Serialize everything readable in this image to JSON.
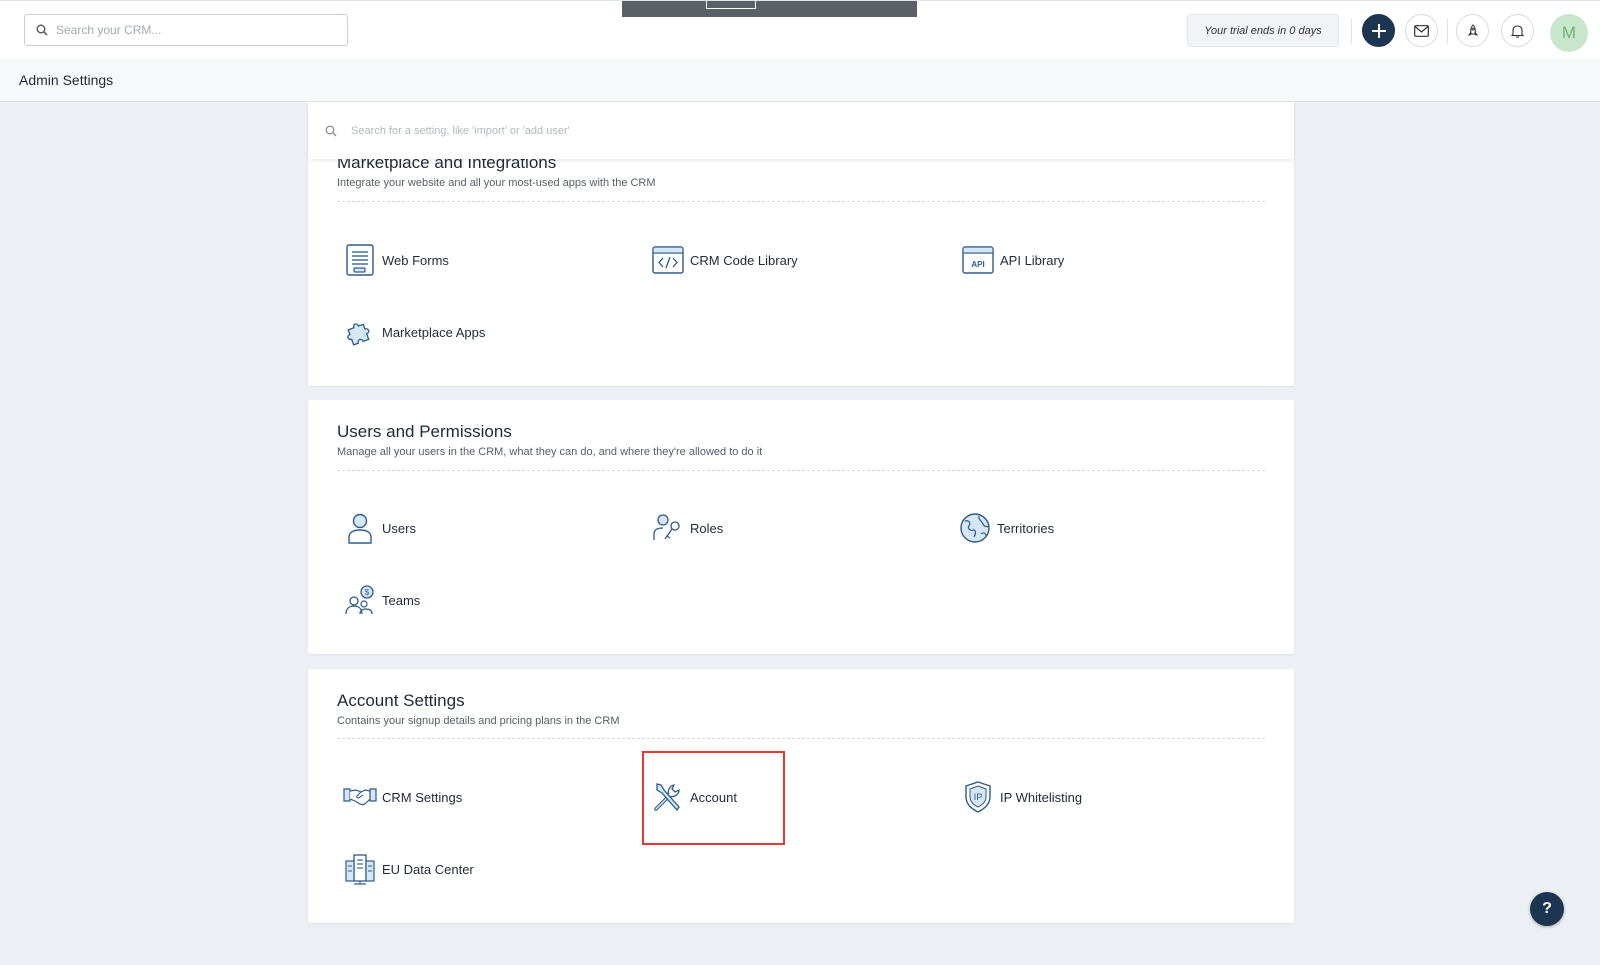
{
  "topbar": {
    "search_placeholder": "Search your CRM...",
    "trial_text": "Your trial ends in 0 days",
    "avatar_initial": "M",
    "icons": [
      "search-icon",
      "plus-icon",
      "mail-icon",
      "rocket-icon",
      "bell-icon"
    ]
  },
  "header": {
    "title": "Admin Settings"
  },
  "settings_search": {
    "placeholder": "Search for a setting, like 'import' or 'add user'"
  },
  "sections": {
    "marketplace": {
      "title": "Marketplace and Integrations",
      "description": "Integrate your website and all your most-used apps with the CRM",
      "items": [
        {
          "label": "Web Forms",
          "icon": "web-forms-icon"
        },
        {
          "label": "CRM Code Library",
          "icon": "code-library-icon"
        },
        {
          "label": "API Library",
          "icon": "api-icon"
        },
        {
          "label": "Marketplace Apps",
          "icon": "puzzle-icon"
        }
      ]
    },
    "users": {
      "title": "Users and Permissions",
      "description": "Manage all your users in the CRM, what they can do, and where they're allowed to do it",
      "items": [
        {
          "label": "Users",
          "icon": "user-icon"
        },
        {
          "label": "Roles",
          "icon": "roles-icon"
        },
        {
          "label": "Territories",
          "icon": "globe-icon"
        },
        {
          "label": "Teams",
          "icon": "teams-icon"
        }
      ]
    },
    "account": {
      "title": "Account Settings",
      "description": "Contains your signup details and pricing plans in the CRM",
      "items": [
        {
          "label": "CRM Settings",
          "icon": "handshake-icon"
        },
        {
          "label": "Account",
          "icon": "tools-icon"
        },
        {
          "label": "IP Whitelisting",
          "icon": "ip-shield-icon"
        },
        {
          "label": "EU Data Center",
          "icon": "data-center-icon"
        }
      ]
    }
  },
  "help": {
    "label": "?"
  },
  "colors": {
    "brand_dark": "#1c3550",
    "icon_stroke": "#2d5b8a",
    "icon_fill": "#d6e6f5",
    "highlight": "#e53935",
    "avatar_bg": "#c8e6cc"
  }
}
